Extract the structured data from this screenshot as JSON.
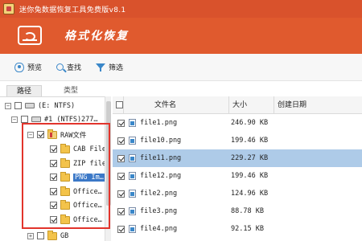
{
  "window": {
    "title": "迷你兔数据恢复工具免费版v8.1"
  },
  "header": {
    "mode_title": "格式化恢复"
  },
  "toolbar": {
    "items": [
      {
        "label": "预览",
        "icon": "eye-icon"
      },
      {
        "label": "查找",
        "icon": "search-icon"
      },
      {
        "label": "筛选",
        "icon": "filter-icon"
      }
    ]
  },
  "tabs": {
    "path": "路径",
    "type": "类型"
  },
  "tree": {
    "root_label": "(E: NTFS)",
    "partition_label": "#1 (NTFS)277…",
    "raw_folder": "RAW文件",
    "items": [
      {
        "label": "CAB File"
      },
      {
        "label": "ZIP file"
      },
      {
        "label": "PNG Im…"
      },
      {
        "label": "Office…"
      },
      {
        "label": "Office…"
      },
      {
        "label": "Office…"
      }
    ],
    "gb_folder": "GB"
  },
  "list": {
    "columns": {
      "name": "文件名",
      "size": "大小",
      "created": "创建日期"
    },
    "rows": [
      {
        "name": "file1.png",
        "size": "246.90 KB"
      },
      {
        "name": "file10.png",
        "size": "199.46 KB"
      },
      {
        "name": "file11.png",
        "size": "229.27 KB"
      },
      {
        "name": "file12.png",
        "size": "199.46 KB"
      },
      {
        "name": "file2.png",
        "size": "124.96 KB"
      },
      {
        "name": "file3.png",
        "size": "88.78 KB"
      },
      {
        "name": "file4.png",
        "size": "92.15 KB"
      }
    ]
  }
}
